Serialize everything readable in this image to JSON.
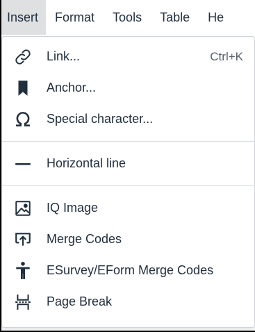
{
  "menubar": {
    "items": [
      {
        "label": "Insert"
      },
      {
        "label": "Format"
      },
      {
        "label": "Tools"
      },
      {
        "label": "Table"
      },
      {
        "label": "He"
      }
    ]
  },
  "insert_menu": {
    "items": [
      {
        "label": "Link...",
        "shortcut": "Ctrl+K",
        "icon": "link-icon"
      },
      {
        "label": "Anchor...",
        "icon": "bookmark-icon"
      },
      {
        "label": "Special character...",
        "icon": "omega-icon"
      },
      {
        "label": "Horizontal line",
        "icon": "horizontal-line-icon"
      },
      {
        "label": "IQ Image",
        "icon": "image-icon"
      },
      {
        "label": "Merge Codes",
        "icon": "merge-codes-icon"
      },
      {
        "label": "ESurvey/EForm Merge Codes",
        "icon": "person-icon"
      },
      {
        "label": "Page Break",
        "icon": "page-break-icon"
      }
    ]
  }
}
